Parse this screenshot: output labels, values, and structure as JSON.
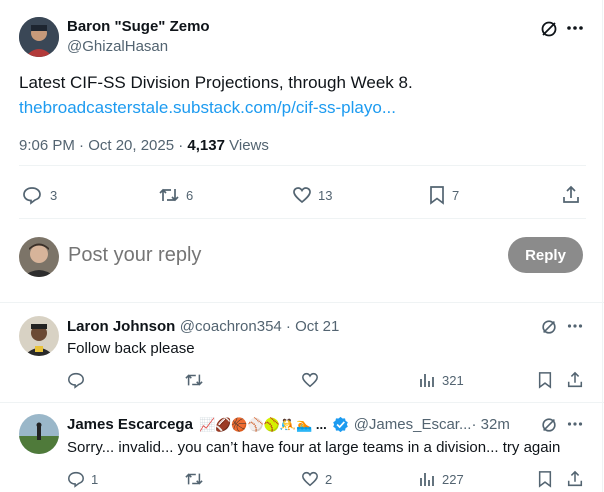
{
  "post": {
    "author_name": "Baron \"Suge\" Zemo",
    "author_handle": "@GhizalHasan",
    "text": "Latest CIF-SS Division Projections, through Week 8.",
    "link": "thebroadcasterstale.substack.com/p/cif-ss-playo...",
    "time": "9:06 PM · Oct 20, 2025 · ",
    "views_count": "4,137",
    "views_label": " Views",
    "replies": "3",
    "reposts": "6",
    "likes": "13",
    "bookmarks": "7"
  },
  "composer": {
    "placeholder": "Post your reply",
    "reply_button": "Reply"
  },
  "replies": [
    {
      "name": "Laron Johnson",
      "handle": "@coachron354",
      "time": " · Oct 21",
      "text": "Follow back please",
      "views": "321"
    },
    {
      "name": "James Escarcega",
      "emojis": "📈🏈🏀⚾🥎🤼🏊 ...",
      "handle": "@James_Escar...",
      "time": " · 32m",
      "text": "Sorry... invalid... you can’t have four at large teams in a division... try again",
      "replies": "1",
      "likes": "2",
      "views": "227"
    }
  ],
  "colors": {
    "link": "#1d9bf0",
    "secondary": "#536471",
    "verified": "#1d9bf0",
    "reply_button_bg": "#8b8b8b"
  }
}
